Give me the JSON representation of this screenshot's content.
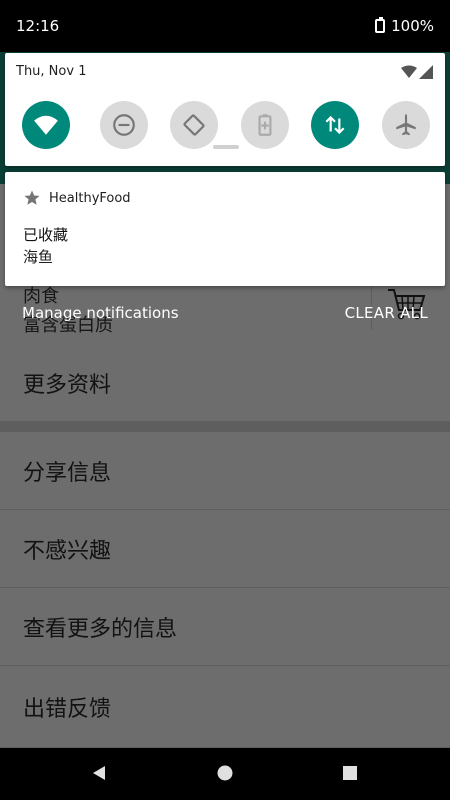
{
  "status_bar": {
    "time": "12:16",
    "battery": "100%"
  },
  "shade": {
    "date": "Thu, Nov 1",
    "quick_settings": [
      {
        "name": "wifi",
        "icon": "wifi-icon",
        "state": "on"
      },
      {
        "name": "dnd",
        "icon": "do-not-disturb-icon",
        "state": "off"
      },
      {
        "name": "auto-rotate",
        "icon": "rotate-icon",
        "state": "off"
      },
      {
        "name": "battery-saver",
        "icon": "battery-saver-icon",
        "state": "off"
      },
      {
        "name": "mobile-data",
        "icon": "data-arrows-icon",
        "state": "on"
      },
      {
        "name": "airplane",
        "icon": "airplane-icon",
        "state": "off"
      }
    ]
  },
  "notification": {
    "app_name": "HealthyFood",
    "title": "已收藏",
    "text": "海鱼"
  },
  "actions": {
    "manage": "Manage notifications",
    "clear_all": "CLEAR ALL"
  },
  "app_content": {
    "meat": "肉食",
    "protein": "富含蛋白质",
    "more_info": "更多资料",
    "share": "分享信息",
    "not_interested": "不感兴趣",
    "view_more": "查看更多的信息",
    "feedback": "出错反馈"
  },
  "colors": {
    "accent": "#00897b",
    "scrim": "#6d6d6d"
  }
}
